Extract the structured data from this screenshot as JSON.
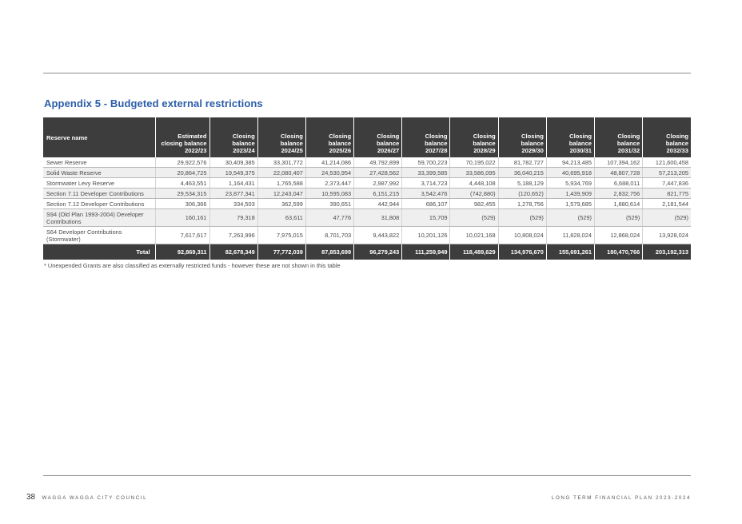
{
  "title": "Appendix 5 - Budgeted external restrictions",
  "table": {
    "headers": [
      "Reserve name",
      "Estimated closing balance 2022/23",
      "Closing balance 2023/24",
      "Closing balance 2024/25",
      "Closing balance 2025/26",
      "Closing balance 2026/27",
      "Closing balance 2027/28",
      "Closing balance 2028/29",
      "Closing balance 2029/30",
      "Closing balance 2030/31",
      "Closing balance 2031/32",
      "Closing balance 2032/33"
    ],
    "rows": [
      [
        "Sewer Reserve",
        "29,922,576",
        "30,409,385",
        "33,301,772",
        "41,214,086",
        "49,792,899",
        "59,700,223",
        "70,195,022",
        "81,782,727",
        "94,213,485",
        "107,394,162",
        "121,600,458"
      ],
      [
        "Solid Waste Reserve",
        "20,864,725",
        "19,549,375",
        "22,080,407",
        "24,530,954",
        "27,428,562",
        "33,399,585",
        "33,586,095",
        "36,040,215",
        "40,695,918",
        "48,807,728",
        "57,213,205"
      ],
      [
        "Stormwater Levy Reserve",
        "4,463,551",
        "1,164,431",
        "1,765,588",
        "2,373,447",
        "2,987,992",
        "3,714,723",
        "4,448,108",
        "5,188,129",
        "5,934,769",
        "6,688,011",
        "7,447,836"
      ],
      [
        "Section 7.11 Developer Contributions",
        "29,534,315",
        "23,877,341",
        "12,243,047",
        "10,595,083",
        "6,151,215",
        "3,542,476",
        "(742,880)",
        "(120,652)",
        "1,439,909",
        "2,832,756",
        "821,775"
      ],
      [
        "Section 7.12 Developer Contributions",
        "306,366",
        "334,503",
        "362,599",
        "390,651",
        "442,944",
        "686,107",
        "982,455",
        "1,278,756",
        "1,579,685",
        "1,880,614",
        "2,181,544"
      ],
      [
        "S94 (Old Plan 1993-2004) Developer Contributions",
        "160,161",
        "79,318",
        "63,611",
        "47,776",
        "31,808",
        "15,709",
        "(529)",
        "(529)",
        "(529)",
        "(529)",
        "(529)"
      ],
      [
        "S64 Developer Contributions (Stormwater)",
        "7,617,617",
        "7,263,996",
        "7,975,015",
        "8,701,703",
        "9,443,822",
        "10,201,126",
        "10,021,168",
        "10,808,024",
        "11,828,024",
        "12,868,024",
        "13,928,024"
      ]
    ],
    "total": [
      "Total",
      "92,869,311",
      "82,678,349",
      "77,772,039",
      "87,853,699",
      "96,279,243",
      "111,259,949",
      "118,489,629",
      "134,976,670",
      "155,691,261",
      "180,470,766",
      "203,192,313"
    ]
  },
  "footnote": "* Unexpended Grants are also classified as externally restricted funds - however these are not shown in this table",
  "footer": {
    "page_number": "38",
    "council": "WAGGA WAGGA CITY COUNCIL",
    "document": "LONG TERM FINANCIAL PLAN 2023-2024"
  },
  "colors": {
    "title": "#2c5da8",
    "header_bg": "#3d3d3d",
    "row_stripe": "#efefef",
    "rule": "#8c8c8c"
  }
}
